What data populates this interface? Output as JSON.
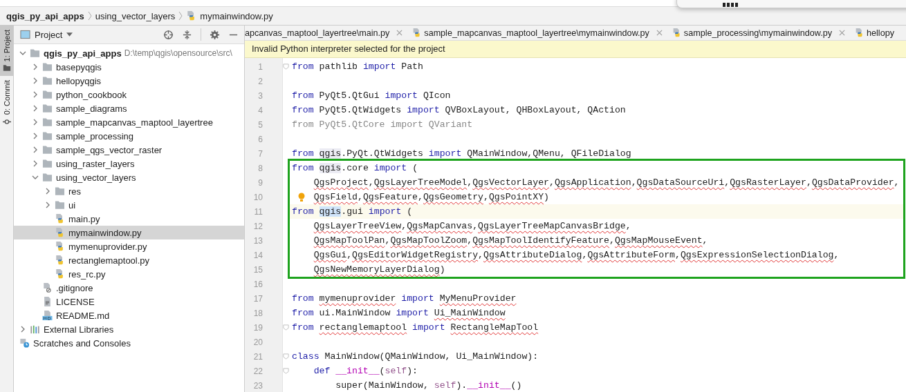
{
  "breadcrumb": [
    {
      "label": "qgis_py_api_apps",
      "kind": "project"
    },
    {
      "label": "using_vector_layers",
      "kind": "folder"
    },
    {
      "label": "mymainwindow.py",
      "kind": "python"
    }
  ],
  "side_strip": [
    {
      "label": "1: Project",
      "selected": true,
      "kind": "folder"
    },
    {
      "label": "0: Commit",
      "selected": false,
      "kind": "commit"
    }
  ],
  "project_panel": {
    "title": "Project",
    "tree": [
      {
        "name": "qgis_py_api_apps",
        "path": "D:\\temp\\qgis\\opensource\\src\\",
        "kind": "folder",
        "bold": true,
        "expanded": true,
        "selected": false,
        "children": [
          {
            "name": "basepyqgis",
            "kind": "folder",
            "expanded": false,
            "selected": false
          },
          {
            "name": "hellopyqgis",
            "kind": "folder",
            "expanded": false,
            "selected": false
          },
          {
            "name": "python_cookbook",
            "kind": "folder",
            "expanded": false,
            "selected": false
          },
          {
            "name": "sample_diagrams",
            "kind": "folder",
            "expanded": false,
            "selected": false
          },
          {
            "name": "sample_mapcanvas_maptool_layertree",
            "kind": "folder",
            "expanded": false,
            "selected": false
          },
          {
            "name": "sample_processing",
            "kind": "folder",
            "expanded": false,
            "selected": false
          },
          {
            "name": "sample_qgs_vector_raster",
            "kind": "folder",
            "expanded": false,
            "selected": false
          },
          {
            "name": "using_raster_layers",
            "kind": "folder",
            "expanded": false,
            "selected": false
          },
          {
            "name": "using_vector_layers",
            "kind": "folder",
            "expanded": true,
            "selected": false,
            "children": [
              {
                "name": "res",
                "kind": "folder",
                "expanded": false,
                "selected": false
              },
              {
                "name": "ui",
                "kind": "folder",
                "expanded": false,
                "selected": false
              },
              {
                "name": "main.py",
                "kind": "python",
                "selected": false
              },
              {
                "name": "mymainwindow.py",
                "kind": "python",
                "selected": true
              },
              {
                "name": "mymenuprovider.py",
                "kind": "python",
                "selected": false
              },
              {
                "name": "rectanglemaptool.py",
                "kind": "python",
                "selected": false
              },
              {
                "name": "res_rc.py",
                "kind": "python",
                "selected": false
              }
            ]
          },
          {
            "name": ".gitignore",
            "kind": "ignored",
            "selected": false
          },
          {
            "name": "LICENSE",
            "kind": "text",
            "selected": false
          },
          {
            "name": "README.md",
            "kind": "markdown",
            "selected": false
          }
        ]
      },
      {
        "name": "External Libraries",
        "kind": "libraries",
        "expanded": false,
        "selected": false
      },
      {
        "name": "Scratches and Consoles",
        "kind": "scratches",
        "selected": false
      }
    ]
  },
  "tabs": [
    {
      "label": "apcanvas_maptool_layertree\\main.py",
      "icon": false,
      "selected": false
    },
    {
      "label": "sample_mapcanvas_maptool_layertree\\mymainwindow.py",
      "icon": true,
      "selected": false
    },
    {
      "label": "sample_processing\\mymainwindow.py",
      "icon": true,
      "selected": false
    },
    {
      "label": "hellopy",
      "icon": true,
      "selected": false
    }
  ],
  "banner": "Invalid Python interpreter selected for the project",
  "code": {
    "blocks": [
      {
        "framed": false,
        "lines": [
          {
            "n": "1",
            "fold": true,
            "segs": [
              {
                "kind": "kw",
                "t": "from "
              },
              {
                "kind": "text",
                "t": "pathlib "
              },
              {
                "kind": "kw",
                "t": "import "
              },
              {
                "kind": "text",
                "t": "Path"
              }
            ]
          },
          {
            "n": "2"
          },
          {
            "n": "3",
            "segs": [
              {
                "kind": "kw",
                "t": "from "
              },
              {
                "kind": "text",
                "t": "PyQt5.QtGui "
              },
              {
                "kind": "kw",
                "t": "import "
              },
              {
                "kind": "text",
                "t": "QIcon"
              }
            ]
          },
          {
            "n": "4",
            "segs": [
              {
                "kind": "kw",
                "t": "from "
              },
              {
                "kind": "text",
                "t": "PyQt5.QtWidgets "
              },
              {
                "kind": "kw",
                "t": "import "
              },
              {
                "kind": "text",
                "t": "QVBoxLayout, QHBoxLayout, QAction"
              }
            ]
          },
          {
            "n": "5",
            "segs": [
              {
                "kind": "dim",
                "t": "from PyQt5.QtCore import QVariant"
              }
            ]
          },
          {
            "n": "6"
          },
          {
            "n": "7",
            "segs": [
              {
                "kind": "kw",
                "t": "from "
              },
              {
                "kind": "soft",
                "t": "qgis"
              },
              {
                "kind": "text",
                "t": ".PyQt.QtWidgets "
              },
              {
                "kind": "kw",
                "t": "import "
              },
              {
                "kind": "text",
                "t": "QMainWindow,QMenu, QFileDialog"
              }
            ]
          }
        ]
      },
      {
        "framed": true,
        "lines": [
          {
            "n": "8",
            "segs": [
              {
                "kind": "kw",
                "t": "from "
              },
              {
                "kind": "soft",
                "t": "qgis"
              },
              {
                "kind": "text",
                "t": ".core "
              },
              {
                "kind": "kw",
                "t": "import "
              },
              {
                "kind": "text",
                "t": "("
              }
            ]
          },
          {
            "n": "9",
            "kind": "indented",
            "segs": [
              {
                "kind": "err",
                "t": "QgsProject"
              },
              {
                "kind": "text",
                "t": ","
              },
              {
                "kind": "err",
                "t": "QgsLayerTreeModel"
              },
              {
                "kind": "text",
                "t": ","
              },
              {
                "kind": "err",
                "t": "QgsVectorLayer"
              },
              {
                "kind": "text",
                "t": ","
              },
              {
                "kind": "err",
                "t": "QgsApplication"
              },
              {
                "kind": "text",
                "t": ","
              },
              {
                "kind": "err",
                "t": "QgsDataSourceUri"
              },
              {
                "kind": "text",
                "t": ","
              },
              {
                "kind": "err",
                "t": "QgsRasterLayer"
              },
              {
                "kind": "text",
                "t": ","
              },
              {
                "kind": "err",
                "t": "QgsDataProvider"
              },
              {
                "kind": "text",
                "t": ","
              }
            ]
          },
          {
            "n": "10",
            "kind": "indented",
            "bulb": true,
            "segs": [
              {
                "kind": "err",
                "t": "QgsField"
              },
              {
                "kind": "text",
                "t": ","
              },
              {
                "kind": "err",
                "t": "QgsFeature"
              },
              {
                "kind": "text",
                "t": ","
              },
              {
                "kind": "err",
                "t": "QgsGeometry"
              },
              {
                "kind": "text",
                "t": ","
              },
              {
                "kind": "err",
                "t": "QgsPointXY"
              },
              {
                "kind": "text",
                "t": ")"
              }
            ]
          },
          {
            "n": "11",
            "current": true,
            "segs": [
              {
                "kind": "kw",
                "t": "from "
              },
              {
                "kind": "hl",
                "t": "qgis"
              },
              {
                "kind": "text",
                "t": ".gui "
              },
              {
                "kind": "kw",
                "t": "import "
              },
              {
                "kind": "text",
                "t": "("
              }
            ]
          },
          {
            "n": "12",
            "kind": "indented",
            "segs": [
              {
                "kind": "err",
                "t": "QgsLayerTreeView"
              },
              {
                "kind": "text",
                "t": ","
              },
              {
                "kind": "err",
                "t": "QgsMapCanvas"
              },
              {
                "kind": "text",
                "t": ","
              },
              {
                "kind": "err",
                "t": "QgsLayerTreeMapCanvasBridge"
              },
              {
                "kind": "text",
                "t": ","
              }
            ]
          },
          {
            "n": "13",
            "kind": "indented",
            "segs": [
              {
                "kind": "err",
                "t": "QgsMapToolPan"
              },
              {
                "kind": "text",
                "t": ","
              },
              {
                "kind": "err",
                "t": "QgsMapToolZoom"
              },
              {
                "kind": "text",
                "t": ","
              },
              {
                "kind": "err",
                "t": "QgsMapToolIdentifyFeature"
              },
              {
                "kind": "text",
                "t": ","
              },
              {
                "kind": "err",
                "t": "QgsMapMouseEvent"
              },
              {
                "kind": "text",
                "t": ","
              }
            ]
          },
          {
            "n": "14",
            "kind": "indented",
            "segs": [
              {
                "kind": "err",
                "t": "QgsGui"
              },
              {
                "kind": "text",
                "t": ","
              },
              {
                "kind": "err",
                "t": "QgsEditorWidgetRegistry"
              },
              {
                "kind": "text",
                "t": ","
              },
              {
                "kind": "err",
                "t": "QgsAttributeDialog"
              },
              {
                "kind": "text",
                "t": ","
              },
              {
                "kind": "err",
                "t": "QgsAttributeForm"
              },
              {
                "kind": "text",
                "t": ","
              },
              {
                "kind": "err",
                "t": "QgsExpressionSelectionDialog"
              },
              {
                "kind": "text",
                "t": ","
              }
            ]
          },
          {
            "n": "15",
            "kind": "indented",
            "segs": [
              {
                "kind": "err",
                "t": "QgsNewMemoryLayerDialog"
              },
              {
                "kind": "text",
                "t": ")"
              }
            ]
          }
        ]
      },
      {
        "framed": false,
        "lines": [
          {
            "n": "16"
          },
          {
            "n": "17",
            "segs": [
              {
                "kind": "kw",
                "t": "from "
              },
              {
                "kind": "err",
                "t": "mymenuprovider"
              },
              {
                "kind": "kw",
                "t": " import "
              },
              {
                "kind": "err",
                "t": "MyMenuProvider"
              }
            ]
          },
          {
            "n": "18",
            "segs": [
              {
                "kind": "kw",
                "t": "from "
              },
              {
                "kind": "text",
                "t": "ui.MainWindow "
              },
              {
                "kind": "kw",
                "t": "import "
              },
              {
                "kind": "err",
                "t": "Ui_MainWindow"
              }
            ]
          },
          {
            "n": "19",
            "fold": true,
            "segs": [
              {
                "kind": "kw",
                "t": "from "
              },
              {
                "kind": "err",
                "t": "rectanglemaptool"
              },
              {
                "kind": "kw",
                "t": " import "
              },
              {
                "kind": "err",
                "t": "RectangleMapTool"
              }
            ]
          },
          {
            "n": "20"
          },
          {
            "n": "21",
            "fold": true,
            "segs": [
              {
                "kind": "kw",
                "t": "class "
              },
              {
                "kind": "text",
                "t": "MainWindow(QMainWindow, Ui_MainWindow):"
              }
            ]
          },
          {
            "n": "22",
            "kind": "indented",
            "fold": true,
            "segs": [
              {
                "kind": "kw",
                "t": "def "
              },
              {
                "kind": "fn",
                "t": "__init__"
              },
              {
                "kind": "text",
                "t": "("
              },
              {
                "kind": "self",
                "t": "self"
              },
              {
                "kind": "text",
                "t": "):"
              }
            ]
          },
          {
            "n": "23",
            "kind": "nested",
            "segs": [
              {
                "kind": "text",
                "t": "super(MainWindow, "
              },
              {
                "kind": "self",
                "t": "self"
              },
              {
                "kind": "text",
                "t": ")."
              },
              {
                "kind": "fn",
                "t": "__init__"
              },
              {
                "kind": "text",
                "t": "()"
              }
            ]
          }
        ]
      }
    ]
  }
}
